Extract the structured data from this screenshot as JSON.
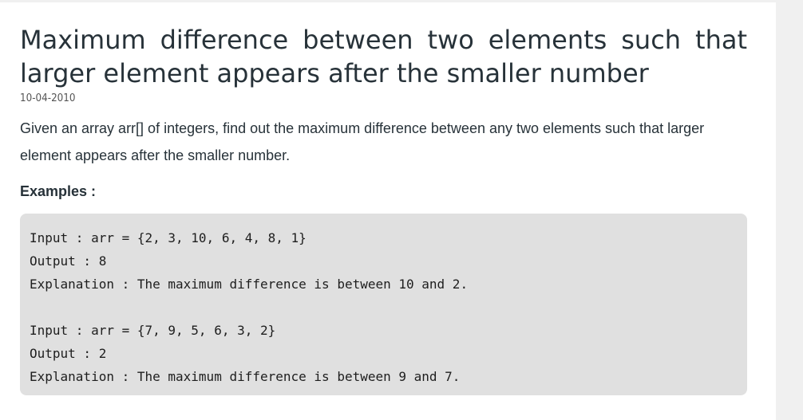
{
  "article": {
    "title": "Maximum difference between two elements such that larger element appears after the smaller number",
    "date": "10-04-2010",
    "description": "Given an array arr[] of integers, find out the maximum difference between any two elements such that larger element appears after the smaller number.",
    "examples_heading": "Examples :",
    "code_lines": [
      "Input : arr = {2, 3, 10, 6, 4, 8, 1}",
      "Output : 8",
      "Explanation : The maximum difference is between 10 and 2.",
      "",
      "Input : arr = {7, 9, 5, 6, 3, 2}",
      "Output : 2",
      "Explanation : The maximum difference is between 9 and 7."
    ]
  }
}
